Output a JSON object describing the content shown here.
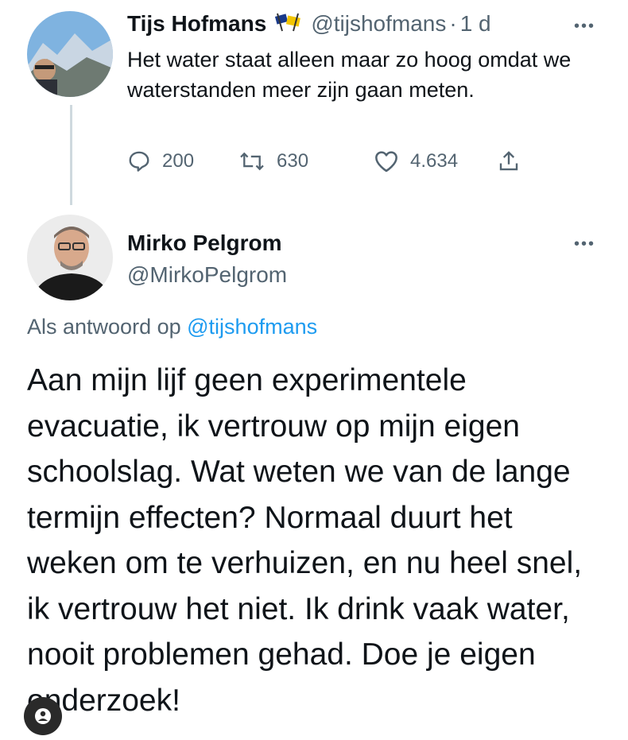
{
  "tweet1": {
    "name": "Tijs Hofmans",
    "handle": "@tijshofmans",
    "separator": "·",
    "time": "1 d",
    "text": "Het water staat alleen maar zo hoog omdat we waterstanden meer zijn gaan meten.",
    "more": "•••",
    "stats": {
      "replies": "200",
      "retweets": "630",
      "likes": "4.634"
    }
  },
  "tweet2": {
    "name": "Mirko Pelgrom",
    "handle": "@MirkoPelgrom",
    "more": "•••",
    "reply_prefix": "Als antwoord op",
    "reply_mention": "@tijshofmans",
    "text": "Aan mijn lijf geen experimentele evacuatie, ik vertrouw op mijn eigen schoolslag. Wat weten we van de lange termijn effecten? Normaal duurt het weken om te verhuizen, en nu heel snel, ik vertrouw het niet. Ik drink vaak water, nooit problemen gehad. Doe je eigen onderzoek!"
  },
  "colors": {
    "accent": "#1d9bf0",
    "muted": "#536471",
    "text": "#0f1419",
    "thread_line": "#cfd9de"
  },
  "icons": [
    "reply-icon",
    "retweet-icon",
    "like-icon",
    "share-icon",
    "more-icon",
    "flag-emoji-icon",
    "corner-badge-icon"
  ]
}
